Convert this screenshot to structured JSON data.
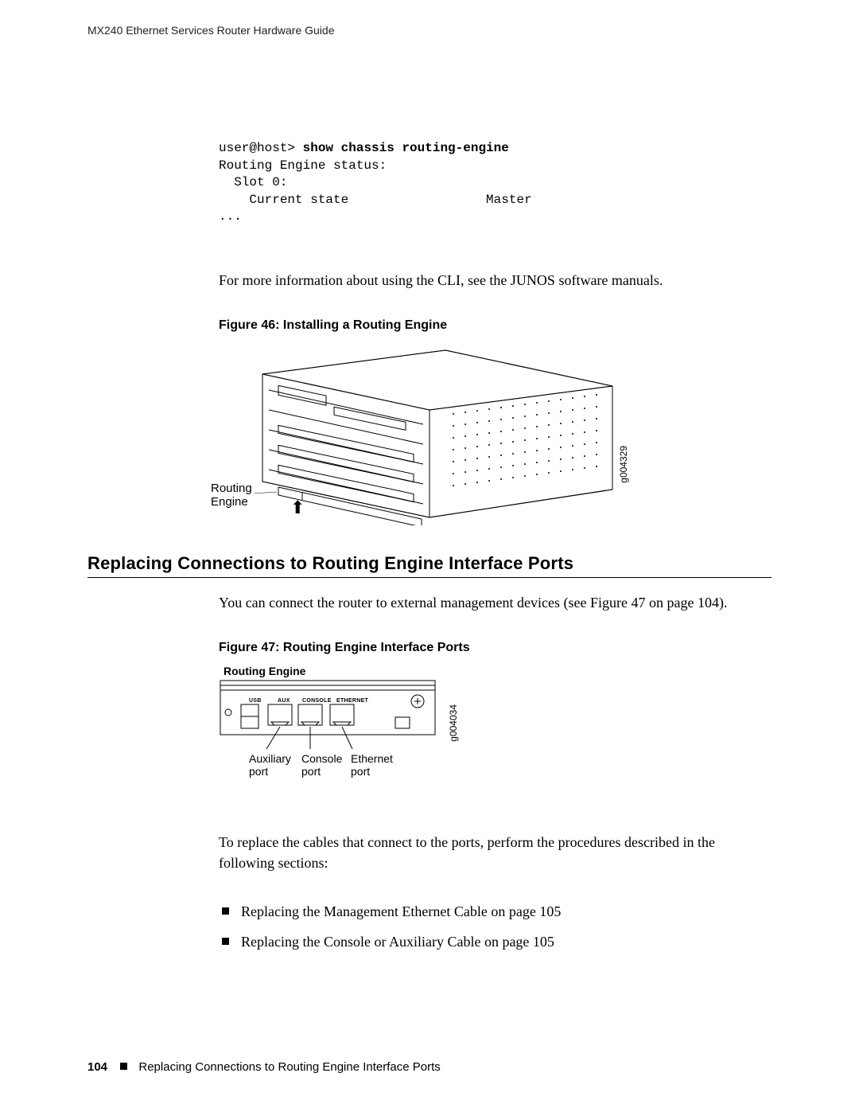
{
  "running_head": "MX240 Ethernet Services Router Hardware Guide",
  "cli": {
    "prompt": "user@host> ",
    "command": "show chassis routing-engine",
    "lines": [
      "Routing Engine status:",
      "  Slot 0:",
      "    Current state                  Master",
      "..."
    ]
  },
  "para_cli_info": "For more information about using the CLI, see the JUNOS software manuals.",
  "fig46": {
    "caption": "Figure 46: Installing a Routing Engine",
    "label_routing_engine": "Routing\nEngine",
    "gcode": "g004329"
  },
  "section_heading": "Replacing Connections to Routing Engine Interface Ports",
  "para_intro": "You can connect the router to external management devices (see Figure 47 on page 104).",
  "fig47": {
    "caption": "Figure 47: Routing Engine Interface Ports",
    "title": "Routing Engine",
    "port_usbs": "USB",
    "port_aux": "AUX",
    "port_console": "CONSOLE",
    "port_eth": "ETHERNET",
    "callout_aux": "Auxiliary\nport",
    "callout_console": "Console\nport",
    "callout_eth": "Ethernet\nport",
    "gcode": "g004034"
  },
  "para_replace": "To replace the cables that connect to the ports, perform the procedures described in the following sections:",
  "bullets": [
    "Replacing the Management Ethernet Cable on page 105",
    "Replacing the Console or Auxiliary Cable on page 105"
  ],
  "footer": {
    "page_no": "104",
    "text": "Replacing Connections to Routing Engine Interface Ports"
  }
}
